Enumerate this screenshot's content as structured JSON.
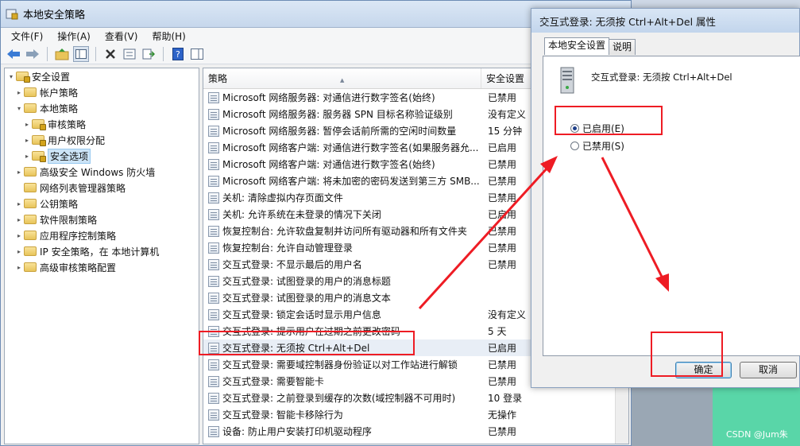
{
  "main_window": {
    "title": "本地安全策略",
    "menu": [
      "文件(F)",
      "操作(A)",
      "查看(V)",
      "帮助(H)"
    ]
  },
  "tree": {
    "items": [
      {
        "label": "安全设置",
        "level": 0,
        "expander": "▾",
        "selected": false
      },
      {
        "label": "帐户策略",
        "level": 1,
        "expander": "▸",
        "selected": false
      },
      {
        "label": "本地策略",
        "level": 1,
        "expander": "▾",
        "selected": false
      },
      {
        "label": "审核策略",
        "level": 2,
        "expander": "▸",
        "selected": false
      },
      {
        "label": "用户权限分配",
        "level": 2,
        "expander": "▸",
        "selected": false
      },
      {
        "label": "安全选项",
        "level": 2,
        "expander": "▸",
        "selected": true
      },
      {
        "label": "高级安全 Windows 防火墙",
        "level": 1,
        "expander": "▸",
        "selected": false
      },
      {
        "label": "网络列表管理器策略",
        "level": 1,
        "expander": "",
        "selected": false
      },
      {
        "label": "公钥策略",
        "level": 1,
        "expander": "▸",
        "selected": false
      },
      {
        "label": "软件限制策略",
        "level": 1,
        "expander": "▸",
        "selected": false
      },
      {
        "label": "应用程序控制策略",
        "level": 1,
        "expander": "▸",
        "selected": false
      },
      {
        "label": "IP 安全策略，在 本地计算机",
        "level": 1,
        "expander": "▸",
        "selected": false
      },
      {
        "label": "高级审核策略配置",
        "level": 1,
        "expander": "▸",
        "selected": false
      }
    ]
  },
  "list": {
    "columns": [
      "策略",
      "安全设置"
    ],
    "rows": [
      {
        "policy": "Microsoft 网络服务器: 对通信进行数字签名(始终)",
        "setting": "已禁用"
      },
      {
        "policy": "Microsoft 网络服务器: 服务器 SPN 目标名称验证级别",
        "setting": "没有定义"
      },
      {
        "policy": "Microsoft 网络服务器: 暂停会话前所需的空闲时间数量",
        "setting": "15 分钟"
      },
      {
        "policy": "Microsoft 网络客户端: 对通信进行数字签名(如果服务器允...",
        "setting": "已启用"
      },
      {
        "policy": "Microsoft 网络客户端: 对通信进行数字签名(始终)",
        "setting": "已禁用"
      },
      {
        "policy": "Microsoft 网络客户端: 将未加密的密码发送到第三方 SMB...",
        "setting": "已禁用"
      },
      {
        "policy": "关机: 清除虚拟内存页面文件",
        "setting": "已禁用"
      },
      {
        "policy": "关机: 允许系统在未登录的情况下关闭",
        "setting": "已启用"
      },
      {
        "policy": "恢复控制台: 允许软盘复制并访问所有驱动器和所有文件夹",
        "setting": "已禁用"
      },
      {
        "policy": "恢复控制台: 允许自动管理登录",
        "setting": "已禁用"
      },
      {
        "policy": "交互式登录: 不显示最后的用户名",
        "setting": "已禁用"
      },
      {
        "policy": "交互式登录: 试图登录的用户的消息标题",
        "setting": ""
      },
      {
        "policy": "交互式登录: 试图登录的用户的消息文本",
        "setting": ""
      },
      {
        "policy": "交互式登录: 锁定会话时显示用户信息",
        "setting": "没有定义"
      },
      {
        "policy": "交互式登录: 提示用户在过期之前更改密码",
        "setting": "5 天"
      },
      {
        "policy": "交互式登录: 无须按 Ctrl+Alt+Del",
        "setting": "已启用"
      },
      {
        "policy": "交互式登录: 需要域控制器身份验证以对工作站进行解锁",
        "setting": "已禁用"
      },
      {
        "policy": "交互式登录: 需要智能卡",
        "setting": "已禁用"
      },
      {
        "policy": "交互式登录: 之前登录到缓存的次数(域控制器不可用时)",
        "setting": "10 登录"
      },
      {
        "policy": "交互式登录: 智能卡移除行为",
        "setting": "无操作"
      },
      {
        "policy": "设备: 防止用户安装打印机驱动程序",
        "setting": "已禁用"
      }
    ]
  },
  "dialog": {
    "title": "交互式登录: 无须按 Ctrl+Alt+Del 属性",
    "tabs": [
      "本地安全设置",
      "说明"
    ],
    "policy_name": "交互式登录: 无须按 Ctrl+Alt+Del",
    "enabled_label": "已启用(E)",
    "disabled_label": "已禁用(S)",
    "selected_option": "enabled",
    "ok_label": "确定",
    "cancel_label": "取消"
  },
  "watermark": "CSDN @Jum朱",
  "colors": {
    "annotation_red": "#ee1c24",
    "selection_blue": "#cce4f7",
    "background_green": "#59d6a8"
  }
}
